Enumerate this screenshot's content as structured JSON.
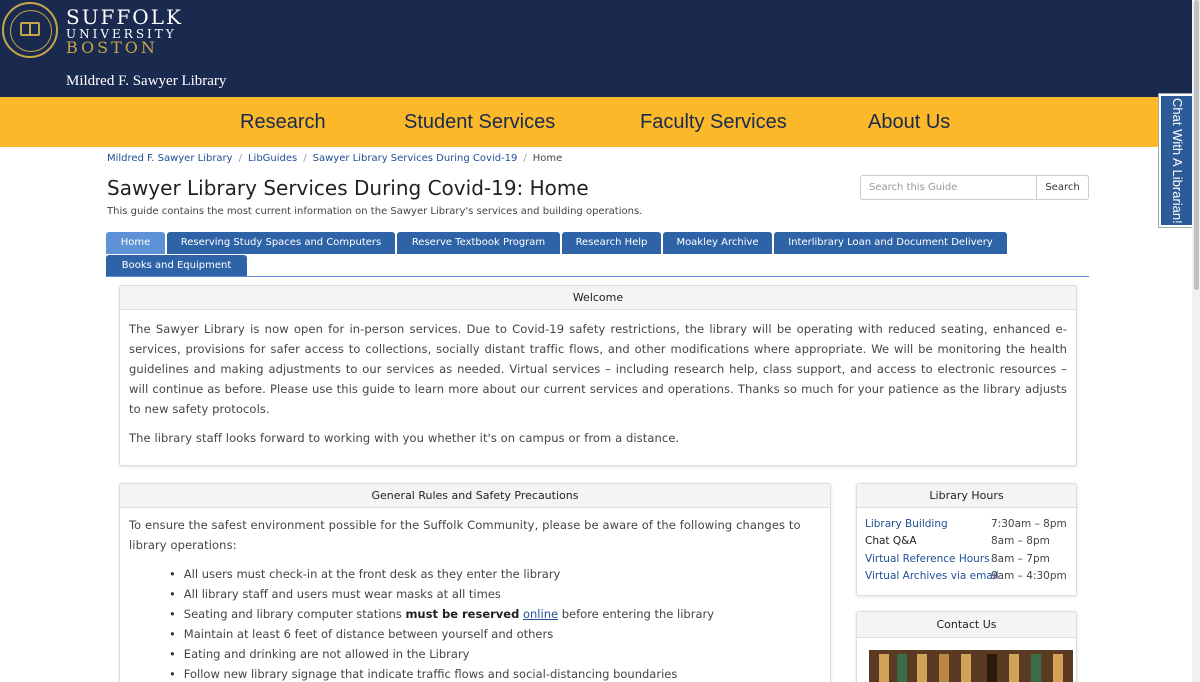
{
  "header": {
    "brand_line1": "SUFFOLK",
    "brand_line2": "UNIVERSITY",
    "brand_line3": "BOSTON",
    "library_name": "Mildred F. Sawyer Library",
    "colors": {
      "navy": "#1a2a4f",
      "gold": "#fbb829",
      "accent": "#c7a54a"
    }
  },
  "nav": {
    "items": [
      {
        "label": "Research"
      },
      {
        "label": "Student Services"
      },
      {
        "label": "Faculty Services"
      },
      {
        "label": "About Us"
      }
    ]
  },
  "chat": {
    "label": "Chat With A Librarian!"
  },
  "breadcrumb": {
    "items": [
      {
        "label": "Mildred F. Sawyer Library"
      },
      {
        "label": "LibGuides"
      },
      {
        "label": "Sawyer Library Services During Covid-19"
      }
    ],
    "current": "Home"
  },
  "page": {
    "title": "Sawyer Library Services During Covid-19: Home",
    "description": "This guide contains the most current information on the Sawyer Library's services and building operations."
  },
  "search": {
    "placeholder": "Search this Guide",
    "button": "Search"
  },
  "tabs": [
    {
      "label": "Home",
      "active": true
    },
    {
      "label": "Reserving Study Spaces and Computers"
    },
    {
      "label": "Reserve Textbook Program"
    },
    {
      "label": "Research Help"
    },
    {
      "label": "Moakley Archive"
    },
    {
      "label": "Interlibrary Loan and Document Delivery"
    },
    {
      "label": "Books and Equipment"
    }
  ],
  "welcome": {
    "heading": "Welcome",
    "para1": "The Sawyer Library is now open for in-person services. Due to Covid-19 safety restrictions, the library will be operating with reduced seating, enhanced e-services, provisions for safer access to collections, socially distant traffic flows, and other modifications where appropriate. We will be monitoring the health guidelines and making adjustments to our services as needed. Virtual services – including research help, class support, and access to electronic resources – will continue as before. Please use this guide to learn more about our current services and operations. Thanks so much for your patience as the library adjusts to new safety protocols.",
    "para2": "The library staff looks forward to working with you whether it's on campus or from a distance."
  },
  "rules": {
    "heading": "General Rules and Safety Precautions",
    "intro": "To ensure the safest environment possible for the Suffolk Community, please be aware of the following changes to library operations:",
    "item1": "All users must check-in at the front desk as they enter the library",
    "item2": "All library staff and users must wear masks at all times",
    "item3_pre": "Seating and library computer stations ",
    "item3_bold": "must be reserved",
    "item3_link": "online",
    "item3_post": " before entering the library",
    "item4": "Maintain at least 6 feet of distance between yourself and others",
    "item5": "Eating and drinking are not allowed in the Library",
    "item6": "Follow new library signage that indicate traffic flows and social-distancing boundaries"
  },
  "hours": {
    "heading": "Library Hours",
    "rows": [
      {
        "label": "Library Building",
        "time": "7:30am – 8pm"
      },
      {
        "label": "Chat Q&A",
        "time": "8am – 8pm"
      },
      {
        "label": "Virtual Reference Hours",
        "time": "8am – 7pm"
      },
      {
        "label": "Virtual Archives via email",
        "time": "9am – 4:30pm"
      }
    ]
  },
  "contact": {
    "heading": "Contact Us"
  }
}
